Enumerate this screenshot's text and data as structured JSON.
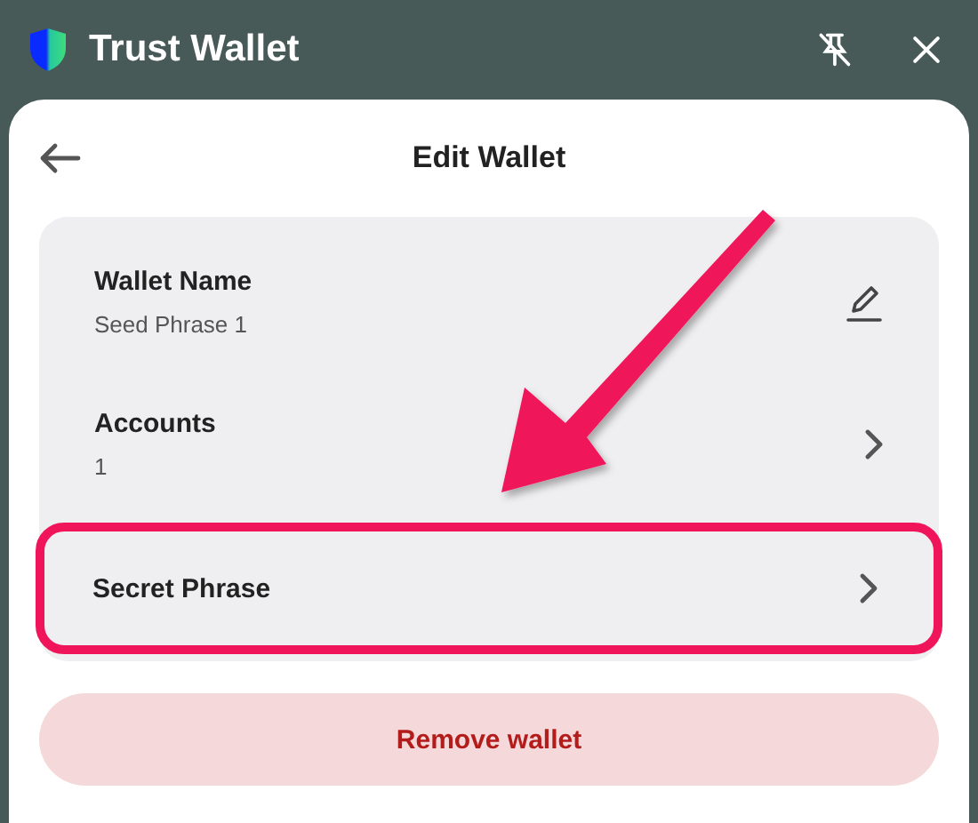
{
  "window": {
    "title": "Trust Wallet"
  },
  "header": {
    "title": "Edit Wallet"
  },
  "items": [
    {
      "kind": "edit",
      "label": "Wallet Name",
      "value": "Seed Phrase 1",
      "highlighted": false
    },
    {
      "kind": "link",
      "label": "Accounts",
      "value": "1",
      "highlighted": false
    },
    {
      "kind": "link",
      "label": "Secret Phrase",
      "highlighted": true
    }
  ],
  "remove_button": "Remove wallet"
}
